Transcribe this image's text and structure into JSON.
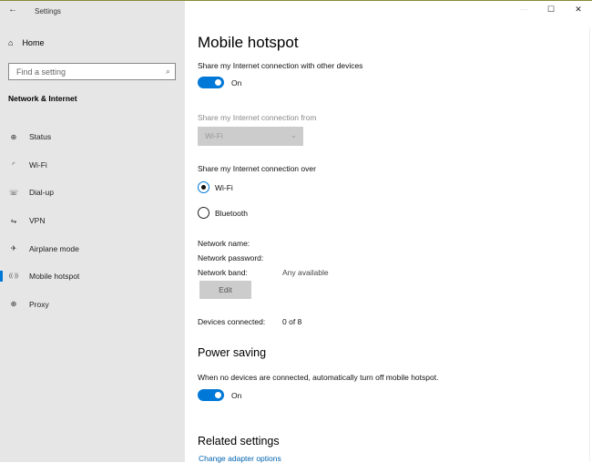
{
  "window": {
    "title": "Settings",
    "back": "←",
    "controls": {
      "minimize": "—",
      "maximize": "☐",
      "close": "✕"
    }
  },
  "sidebar": {
    "home": "Home",
    "search_placeholder": "Find a setting",
    "section": "Network & Internet",
    "items": [
      {
        "label": "Status",
        "icon": "⊕"
      },
      {
        "label": "Wi-Fi",
        "icon": "◜"
      },
      {
        "label": "Dial-up",
        "icon": "☏"
      },
      {
        "label": "VPN",
        "icon": "⇋"
      },
      {
        "label": "Airplane mode",
        "icon": "✈"
      },
      {
        "label": "Mobile hotspot",
        "icon": "((·))"
      },
      {
        "label": "Proxy",
        "icon": "⊕"
      }
    ]
  },
  "main": {
    "title": "Mobile hotspot",
    "share_label": "Share my Internet connection with other devices",
    "share_state": "On",
    "from_label": "Share my Internet connection from",
    "from_value": "Wi-Fi",
    "over_label": "Share my Internet connection over",
    "over_options": [
      "Wi-Fi",
      "Bluetooth"
    ],
    "network_name_label": "Network name:",
    "network_password_label": "Network password:",
    "network_band_label": "Network band:",
    "network_band_value": "Any available",
    "edit": "Edit",
    "devices_label": "Devices connected:",
    "devices_value": "0 of 8",
    "power_title": "Power saving",
    "power_label": "When no devices are connected, automatically turn off mobile hotspot.",
    "power_state": "On",
    "related_title": "Related settings",
    "related_link": "Change adapter options"
  }
}
